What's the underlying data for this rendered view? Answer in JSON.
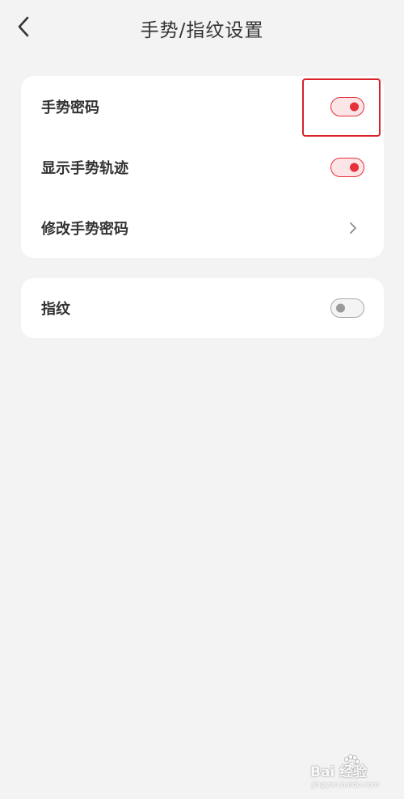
{
  "header": {
    "title": "手势/指纹设置",
    "back_icon": "chevron-left-icon"
  },
  "settings_group_1": {
    "items": [
      {
        "label": "手势密码",
        "control": "toggle",
        "on": true
      },
      {
        "label": "显示手势轨迹",
        "control": "toggle",
        "on": true
      },
      {
        "label": "修改手势密码",
        "control": "chevron",
        "icon": "chevron-right-icon"
      }
    ]
  },
  "settings_group_2": {
    "items": [
      {
        "label": "指纹",
        "control": "toggle",
        "on": false
      }
    ]
  },
  "colors": {
    "accent": "#e8303a",
    "background": "#f3f3f3",
    "card": "#ffffff",
    "text": "#333333",
    "highlight": "#d9222a"
  },
  "watermark": {
    "main": "Bai 经验",
    "sub": "jingyan.baidu.com"
  }
}
